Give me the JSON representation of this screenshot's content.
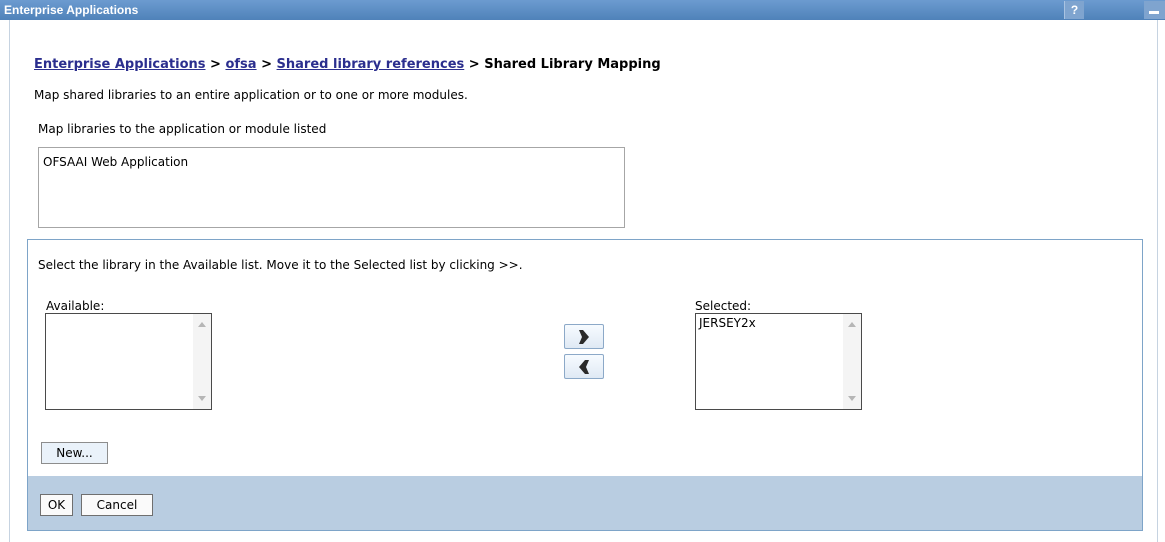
{
  "window": {
    "title": "Enterprise Applications",
    "help_label": "?",
    "accent": "#5d8fc4"
  },
  "breadcrumb": {
    "items": [
      "Enterprise Applications",
      "ofsa",
      "Shared library references"
    ],
    "separator": ">",
    "current": "Shared Library Mapping",
    "link_color": "#2b2e8e"
  },
  "description": "Map shared libraries to an entire application or to one or more modules.",
  "module_section": {
    "label": "Map libraries to the application or module listed",
    "modules": [
      "OFSAAI Web Application"
    ]
  },
  "library_panel": {
    "instructions": "Select the library in the Available list. Move it to the Selected list by clicking >>.",
    "available_label": "Available:",
    "available_items": [],
    "selected_label": "Selected:",
    "selected_items": [
      "JERSEY2x"
    ],
    "add_icon": "arrow-right-icon",
    "remove_icon": "arrow-left-icon",
    "new_button": "New..."
  },
  "footer": {
    "ok_label": "OK",
    "cancel_label": "Cancel",
    "background": "#b9cde1"
  }
}
